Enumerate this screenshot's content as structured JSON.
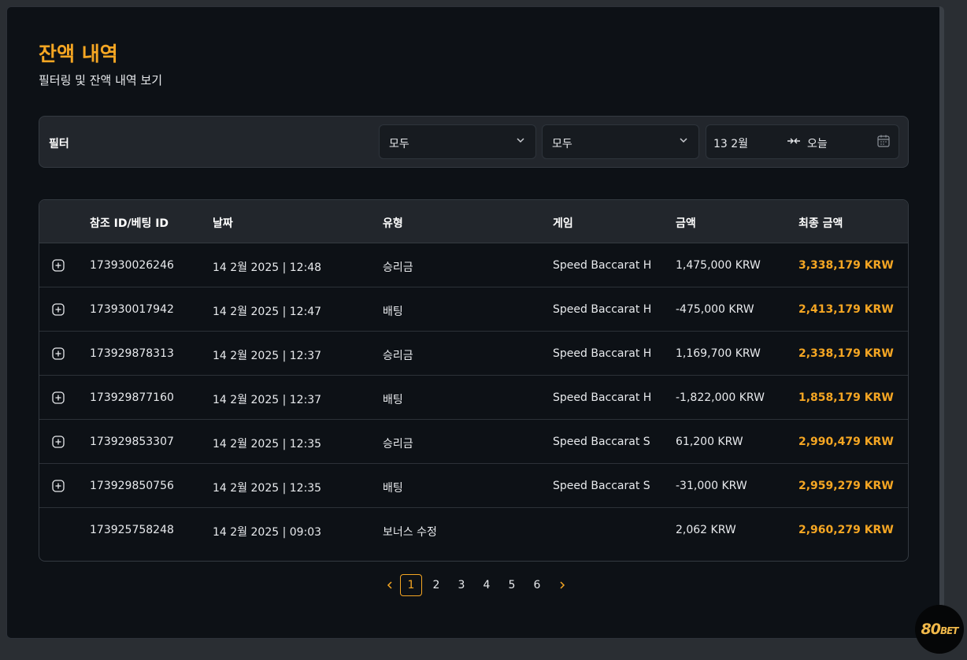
{
  "page": {
    "title": "잔액 내역",
    "subtitle": "필터링 및 잔액 내역 보기"
  },
  "filter": {
    "label": "필터",
    "type_select": "모두",
    "game_select": "모두",
    "date_from": "13 2월",
    "date_to": "오늘"
  },
  "table": {
    "headers": [
      "참조 ID/베팅 ID",
      "날짜",
      "유형",
      "게임",
      "금액",
      "최종 금액"
    ],
    "rows": [
      {
        "id": "173930026246",
        "date": "14 2월 2025 | 12:48",
        "type": "승리금",
        "game": "Speed Baccarat H",
        "amount": "1,475,000 KRW",
        "final": "3,338,179 KRW",
        "expandable": true
      },
      {
        "id": "173930017942",
        "date": "14 2월 2025 | 12:47",
        "type": "배팅",
        "game": "Speed Baccarat H",
        "amount": "-475,000 KRW",
        "final": "2,413,179 KRW",
        "expandable": true
      },
      {
        "id": "173929878313",
        "date": "14 2월 2025 | 12:37",
        "type": "승리금",
        "game": "Speed Baccarat H",
        "amount": "1,169,700 KRW",
        "final": "2,338,179 KRW",
        "expandable": true
      },
      {
        "id": "173929877160",
        "date": "14 2월 2025 | 12:37",
        "type": "배팅",
        "game": "Speed Baccarat H",
        "amount": "-1,822,000 KRW",
        "final": "1,858,179 KRW",
        "expandable": true
      },
      {
        "id": "173929853307",
        "date": "14 2월 2025 | 12:35",
        "type": "승리금",
        "game": "Speed Baccarat S",
        "amount": "61,200 KRW",
        "final": "2,990,479 KRW",
        "expandable": true
      },
      {
        "id": "173929850756",
        "date": "14 2월 2025 | 12:35",
        "type": "배팅",
        "game": "Speed Baccarat S",
        "amount": "-31,000 KRW",
        "final": "2,959,279 KRW",
        "expandable": true
      },
      {
        "id": "173925758248",
        "date": "14 2월 2025 | 09:03",
        "type": "보너스 수정",
        "game": "",
        "amount": "2,062 KRW",
        "final": "2,960,279 KRW",
        "expandable": false
      }
    ]
  },
  "pagination": {
    "pages": [
      "1",
      "2",
      "3",
      "4",
      "5",
      "6"
    ],
    "current": "1"
  },
  "brand": {
    "logo_main": "80",
    "logo_suffix": "BET"
  },
  "colors": {
    "accent": "#f5a623",
    "panel_bg": "#0d1116",
    "header_bg": "#22262c"
  }
}
